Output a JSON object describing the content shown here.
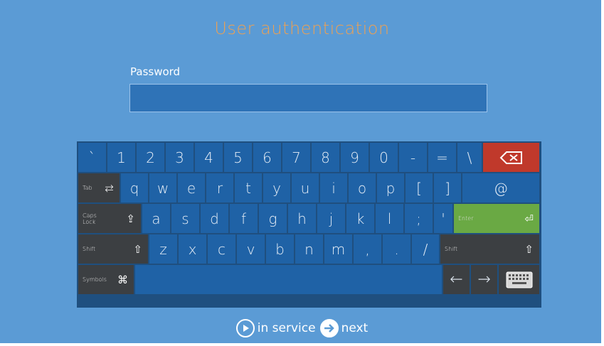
{
  "title": "User authentication",
  "password": {
    "label": "Password",
    "value": "",
    "placeholder": ""
  },
  "keyboard": {
    "row1": [
      "`",
      "1",
      "2",
      "3",
      "4",
      "5",
      "6",
      "7",
      "8",
      "9",
      "0",
      "-",
      "=",
      "\\"
    ],
    "backspace_icon": "backspace-icon",
    "tab_label": "Tab",
    "tab_symbol": "⇄",
    "row2": [
      "q",
      "w",
      "e",
      "r",
      "t",
      "y",
      "u",
      "i",
      "o",
      "p",
      "[",
      "]"
    ],
    "at": "@",
    "caps_label": "Caps Lock",
    "caps_symbol": "⇪",
    "row3": [
      "a",
      "s",
      "d",
      "f",
      "g",
      "h",
      "j",
      "k",
      "l",
      ";",
      "'"
    ],
    "enter_label": "Enter",
    "enter_symbol": "⏎",
    "shift_label": "Shift",
    "shift_symbol": "⇧",
    "row4": [
      "z",
      "x",
      "c",
      "v",
      "b",
      "n",
      "m",
      ",",
      ".",
      "/"
    ],
    "symbols_label": "Symbols",
    "symbols_symbol": "⌘",
    "left_arrow": "←",
    "right_arrow": "→",
    "keyboard_icon": "keyboard-icon"
  },
  "footer": {
    "in_service": "in service",
    "next": "next"
  },
  "colors": {
    "background": "#5b9bd5",
    "title": "#f0a050",
    "key": "#1f62a6",
    "key_dark": "#3c3f42",
    "backspace": "#c0392b",
    "enter": "#6aa944"
  }
}
